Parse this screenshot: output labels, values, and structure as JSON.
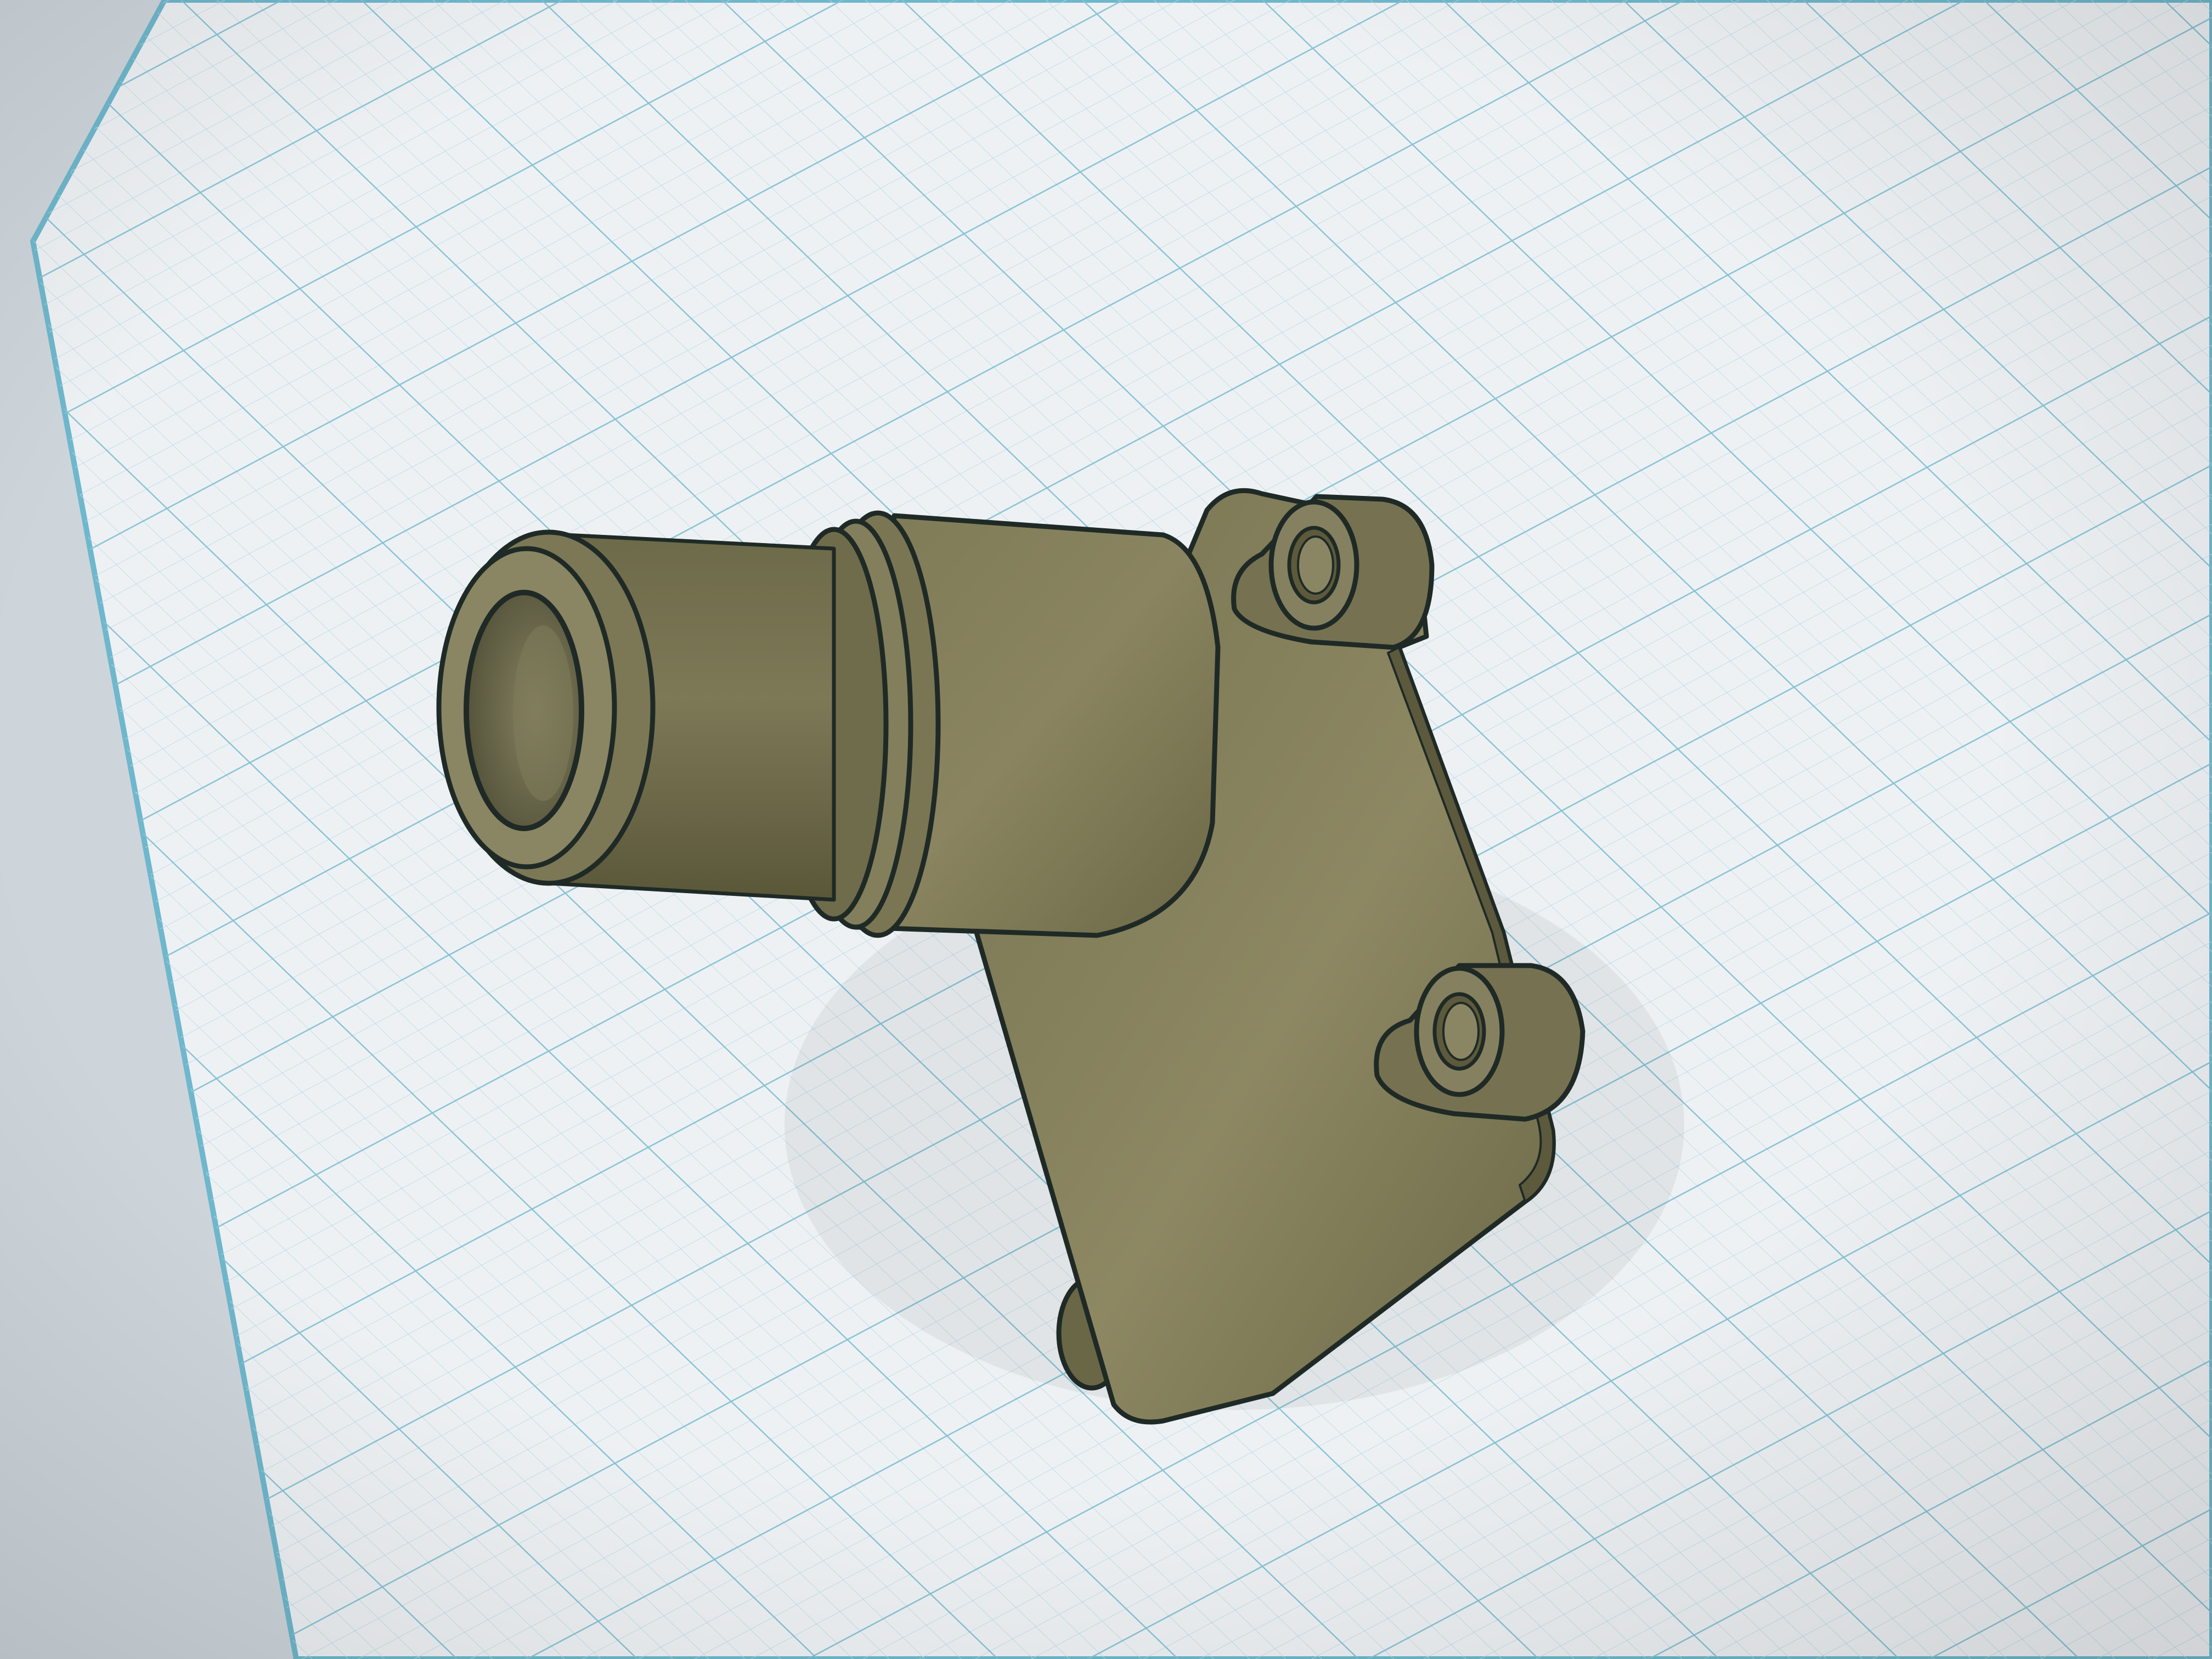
{
  "app": {
    "kind": "3D CAD viewport"
  },
  "viewport": {
    "background_color": "#cdd5db",
    "workplane_color": "#eef1f4",
    "workplane_edge_color": "#6fb7cc",
    "grid_minor_color": "#b9dbe6",
    "grid_major_color": "#7fbfd2"
  },
  "model": {
    "name": "tube-flange-bracket",
    "body_color": "#7b7754",
    "body_shadow_color": "#5c593d",
    "body_highlight_color": "#9a9672",
    "edge_color": "#1f2a26",
    "features": [
      "tube-bore",
      "tube-end-ring",
      "collar-flange",
      "mounting-plate",
      "mounting-boss-top",
      "mounting-boss-bottom",
      "mounting-boss-lower-left"
    ]
  }
}
